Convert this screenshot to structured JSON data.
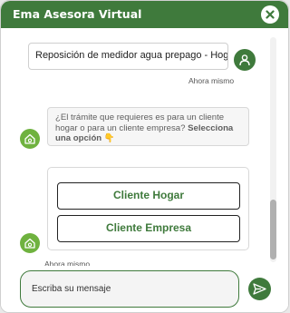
{
  "header": {
    "title": "Ema Asesora Virtual",
    "close_icon": "close-x-icon"
  },
  "colors": {
    "brand_green": "#3f7a3c",
    "bot_avatar_green": "#6fb23f",
    "header_text": "#ffffff"
  },
  "messages": {
    "user_message": {
      "text": "Reposición de medidor agua prepago - Hogar",
      "time": "Ahora mismo",
      "avatar_icon": "user-icon"
    },
    "bot_message": {
      "text_normal": "¿El trámite que requieres es para un cliente hogar o para un cliente empresa? ",
      "text_bold": "Selecciona una opción",
      "emoji": "👇",
      "avatar_icon": "house-plug-icon"
    },
    "options": [
      {
        "label": "Cliente Hogar"
      },
      {
        "label": "Cliente Empresa"
      }
    ],
    "options_time": "Ahora mismo"
  },
  "composer": {
    "placeholder": "Escriba su mensaje",
    "send_icon": "send-icon"
  }
}
